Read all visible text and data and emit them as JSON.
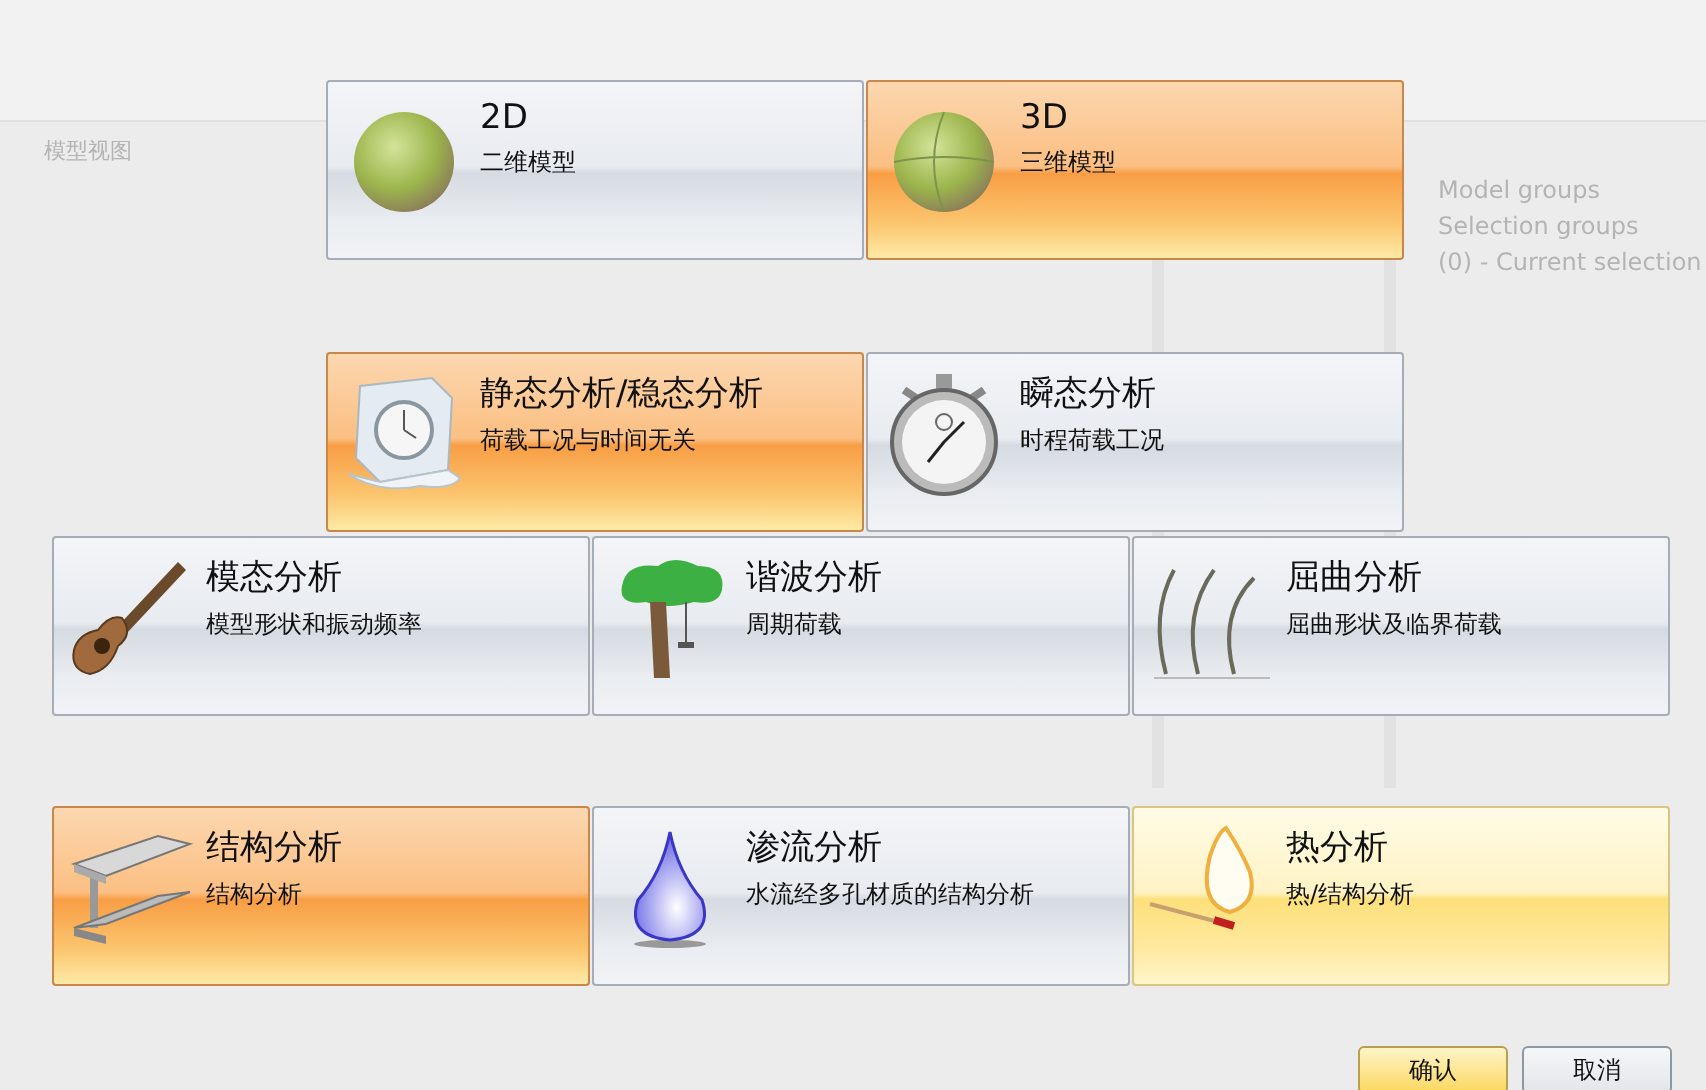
{
  "background": {
    "view_tab": "模型视图",
    "tree_items": [
      "Model groups",
      "Selection groups",
      "(0) - Current selection"
    ]
  },
  "model_types": [
    {
      "title": "2D",
      "subtitle": "二维模型",
      "kind": "sphere",
      "selected": false,
      "hovered": false
    },
    {
      "title": "3D",
      "subtitle": "三维模型",
      "kind": "globe",
      "selected": true,
      "hovered": false
    }
  ],
  "analysis_rows": [
    {
      "items": [
        {
          "title": "静态分析/稳态分析",
          "subtitle": "荷载工况与时间无关",
          "kind": "ice-clock",
          "selected": true,
          "hovered": false
        },
        {
          "title": "瞬态分析",
          "subtitle": "时程荷载工况",
          "kind": "stopwatch",
          "selected": false,
          "hovered": false
        }
      ]
    },
    {
      "items": [
        {
          "title": "模态分析",
          "subtitle": "模型形状和振动频率",
          "kind": "guitar",
          "selected": false,
          "hovered": false
        },
        {
          "title": "谐波分析",
          "subtitle": "周期荷载",
          "kind": "tree",
          "selected": false,
          "hovered": false
        },
        {
          "title": "屈曲分析",
          "subtitle": "屈曲形状及临界荷载",
          "kind": "buckling",
          "selected": false,
          "hovered": false
        }
      ]
    },
    {
      "items": [
        {
          "title": "结构分析",
          "subtitle": "结构分析",
          "kind": "beam",
          "selected": true,
          "hovered": false
        },
        {
          "title": "渗流分析",
          "subtitle": "水流经多孔材质的结构分析",
          "kind": "drop",
          "selected": false,
          "hovered": false
        },
        {
          "title": "热分析",
          "subtitle": "热/结构分析",
          "kind": "match",
          "selected": false,
          "hovered": true
        }
      ]
    }
  ],
  "buttons": [
    {
      "label": "确认",
      "default": true
    },
    {
      "label": "取消",
      "default": false
    }
  ]
}
